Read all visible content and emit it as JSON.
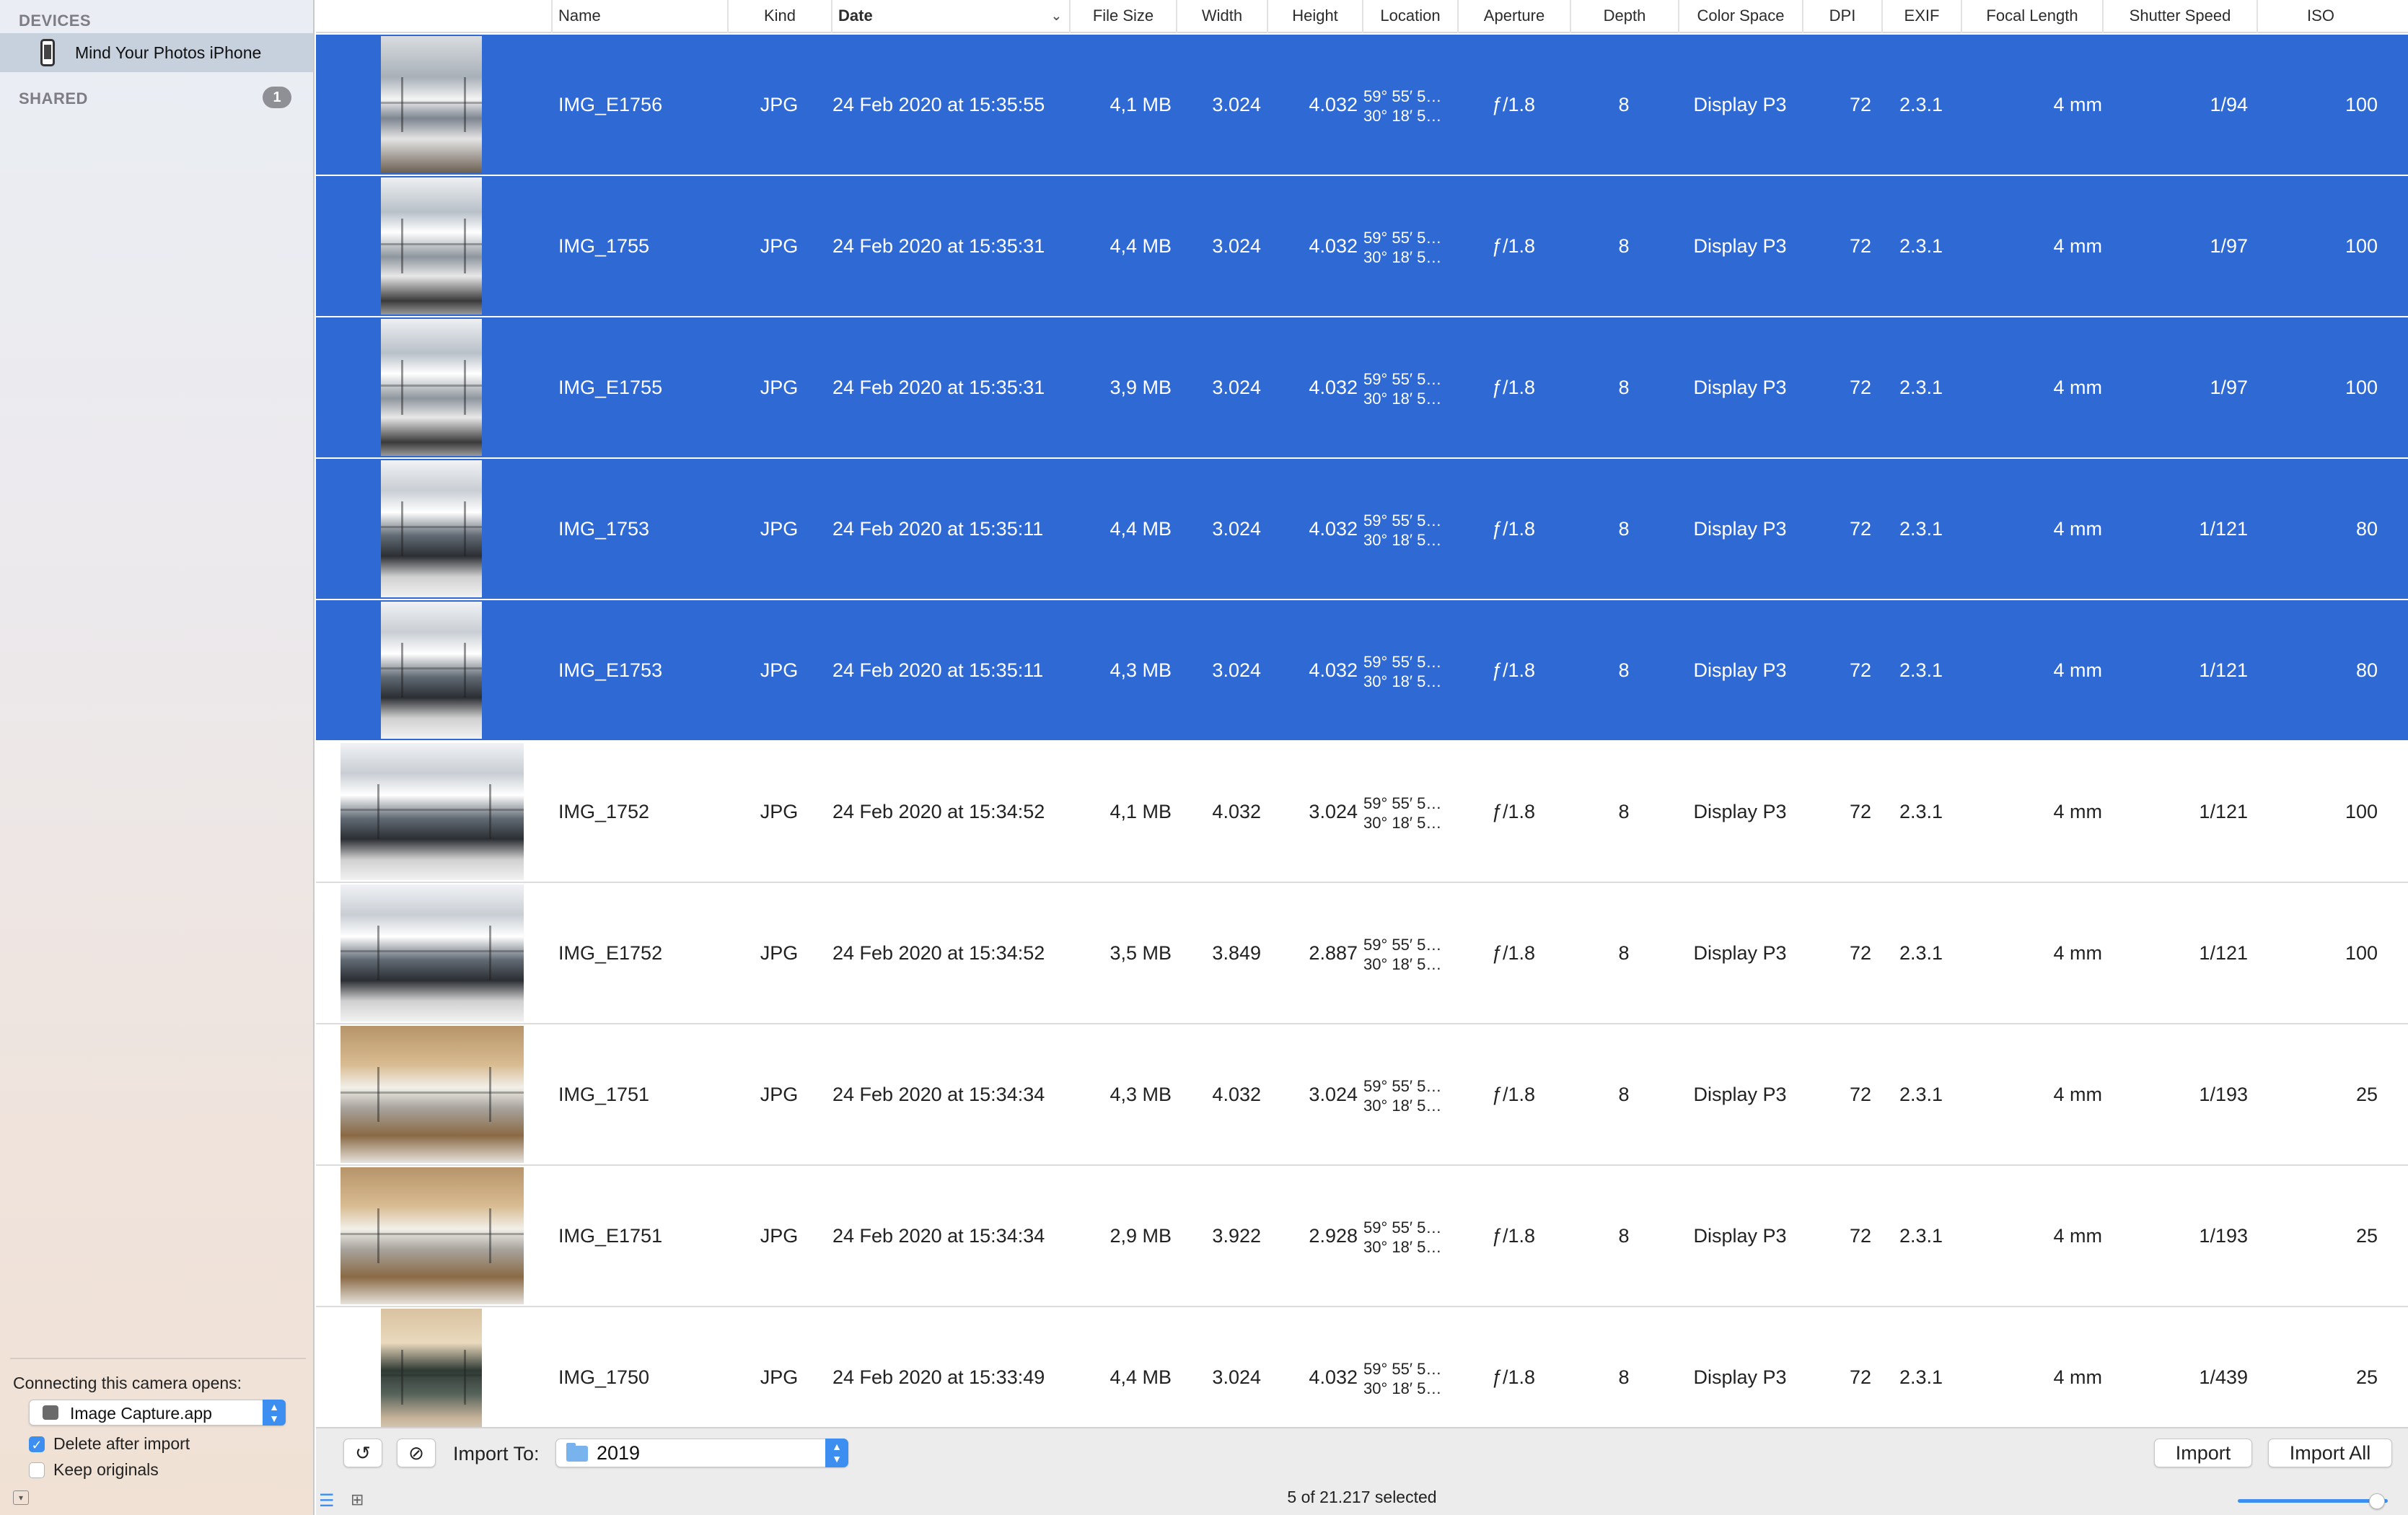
{
  "sidebar": {
    "devices_heading": "DEVICES",
    "device_name": "Mind Your Photos iPhone",
    "shared_heading": "SHARED",
    "shared_count": "1",
    "opens_label": "Connecting this camera opens:",
    "opens_app": "Image Capture.app",
    "delete_after_import": {
      "label": "Delete after import",
      "checked": true
    },
    "keep_originals": {
      "label": "Keep originals",
      "checked": false
    }
  },
  "columns": [
    "Name",
    "Kind",
    "Date",
    "File Size",
    "Width",
    "Height",
    "Location",
    "Aperture",
    "Depth",
    "Color Space",
    "DPI",
    "EXIF",
    "Focal Length",
    "Shutter Speed",
    "ISO"
  ],
  "rows": [
    {
      "name": "IMG_E1756",
      "kind": "JPG",
      "date": "24 Feb 2020 at 15:35:55",
      "size": "4,1 MB",
      "width": "3.024",
      "height": "4.032",
      "location": "59° 55′ 5…\n30° 18′ 5…",
      "aperture": "ƒ/1.8",
      "depth": "8",
      "color_space": "Display P3",
      "dpi": "72",
      "exif": "2.3.1",
      "focal": "4 mm",
      "shutter": "1/94",
      "iso": "100",
      "selected": true,
      "orientation": "portrait",
      "thumb": "t-atrium"
    },
    {
      "name": "IMG_1755",
      "kind": "JPG",
      "date": "24 Feb 2020 at 15:35:31",
      "size": "4,4 MB",
      "width": "3.024",
      "height": "4.032",
      "location": "59° 55′ 5…\n30° 18′ 5…",
      "aperture": "ƒ/1.8",
      "depth": "8",
      "color_space": "Display P3",
      "dpi": "72",
      "exif": "2.3.1",
      "focal": "4 mm",
      "shutter": "1/97",
      "iso": "100",
      "selected": true,
      "orientation": "portrait",
      "thumb": "t-atrium2"
    },
    {
      "name": "IMG_E1755",
      "kind": "JPG",
      "date": "24 Feb 2020 at 15:35:31",
      "size": "3,9 MB",
      "width": "3.024",
      "height": "4.032",
      "location": "59° 55′ 5…\n30° 18′ 5…",
      "aperture": "ƒ/1.8",
      "depth": "8",
      "color_space": "Display P3",
      "dpi": "72",
      "exif": "2.3.1",
      "focal": "4 mm",
      "shutter": "1/97",
      "iso": "100",
      "selected": true,
      "orientation": "portrait",
      "thumb": "t-atrium2"
    },
    {
      "name": "IMG_1753",
      "kind": "JPG",
      "date": "24 Feb 2020 at 15:35:11",
      "size": "4,4 MB",
      "width": "3.024",
      "height": "4.032",
      "location": "59° 55′ 5…\n30° 18′ 5…",
      "aperture": "ƒ/1.8",
      "depth": "8",
      "color_space": "Display P3",
      "dpi": "72",
      "exif": "2.3.1",
      "focal": "4 mm",
      "shutter": "1/121",
      "iso": "80",
      "selected": true,
      "orientation": "portrait",
      "thumb": "t-glass"
    },
    {
      "name": "IMG_E1753",
      "kind": "JPG",
      "date": "24 Feb 2020 at 15:35:11",
      "size": "4,3 MB",
      "width": "3.024",
      "height": "4.032",
      "location": "59° 55′ 5…\n30° 18′ 5…",
      "aperture": "ƒ/1.8",
      "depth": "8",
      "color_space": "Display P3",
      "dpi": "72",
      "exif": "2.3.1",
      "focal": "4 mm",
      "shutter": "1/121",
      "iso": "80",
      "selected": true,
      "orientation": "portrait",
      "thumb": "t-glass"
    },
    {
      "name": "IMG_1752",
      "kind": "JPG",
      "date": "24 Feb 2020 at 15:34:52",
      "size": "4,1 MB",
      "width": "4.032",
      "height": "3.024",
      "location": "59° 55′ 5…\n30° 18′ 5…",
      "aperture": "ƒ/1.8",
      "depth": "8",
      "color_space": "Display P3",
      "dpi": "72",
      "exif": "2.3.1",
      "focal": "4 mm",
      "shutter": "1/121",
      "iso": "100",
      "selected": false,
      "orientation": "landscape",
      "thumb": "t-glass"
    },
    {
      "name": "IMG_E1752",
      "kind": "JPG",
      "date": "24 Feb 2020 at 15:34:52",
      "size": "3,5 MB",
      "width": "3.849",
      "height": "2.887",
      "location": "59° 55′ 5…\n30° 18′ 5…",
      "aperture": "ƒ/1.8",
      "depth": "8",
      "color_space": "Display P3",
      "dpi": "72",
      "exif": "2.3.1",
      "focal": "4 mm",
      "shutter": "1/121",
      "iso": "100",
      "selected": false,
      "orientation": "landscape",
      "thumb": "t-glass"
    },
    {
      "name": "IMG_1751",
      "kind": "JPG",
      "date": "24 Feb 2020 at 15:34:34",
      "size": "4,3 MB",
      "width": "4.032",
      "height": "3.024",
      "location": "59° 55′ 5…\n30° 18′ 5…",
      "aperture": "ƒ/1.8",
      "depth": "8",
      "color_space": "Display P3",
      "dpi": "72",
      "exif": "2.3.1",
      "focal": "4 mm",
      "shutter": "1/193",
      "iso": "25",
      "selected": false,
      "orientation": "landscape",
      "thumb": "t-hall"
    },
    {
      "name": "IMG_E1751",
      "kind": "JPG",
      "date": "24 Feb 2020 at 15:34:34",
      "size": "2,9 MB",
      "width": "3.922",
      "height": "2.928",
      "location": "59° 55′ 5…\n30° 18′ 5…",
      "aperture": "ƒ/1.8",
      "depth": "8",
      "color_space": "Display P3",
      "dpi": "72",
      "exif": "2.3.1",
      "focal": "4 mm",
      "shutter": "1/193",
      "iso": "25",
      "selected": false,
      "orientation": "landscape",
      "thumb": "t-hall"
    },
    {
      "name": "IMG_1750",
      "kind": "JPG",
      "date": "24 Feb 2020 at 15:33:49",
      "size": "4,4 MB",
      "width": "3.024",
      "height": "4.032",
      "location": "59° 55′ 5…\n30° 18′ 5…",
      "aperture": "ƒ/1.8",
      "depth": "8",
      "color_space": "Display P3",
      "dpi": "72",
      "exif": "2.3.1",
      "focal": "4 mm",
      "shutter": "1/439",
      "iso": "25",
      "selected": false,
      "orientation": "portrait",
      "thumb": "t-lobby"
    }
  ],
  "bottom": {
    "rotate_icon": "rotate-left-icon",
    "delete_icon": "no-entry-icon",
    "import_to_label": "Import To:",
    "folder": "2019",
    "import_label": "Import",
    "import_all_label": "Import All",
    "status": "5 of 21.217 selected",
    "thumbnail_zoom": 0.93
  },
  "colors": {
    "selection": "#2f69d3",
    "accent": "#3c8ff0"
  }
}
